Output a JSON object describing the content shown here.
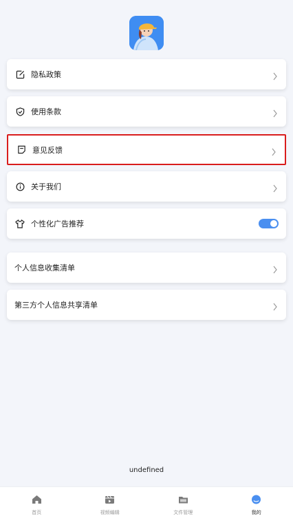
{
  "settings": {
    "items": [
      {
        "label": "隐私政策",
        "icon": "edit-icon"
      },
      {
        "label": "使用条款",
        "icon": "shield-check-icon"
      },
      {
        "label": "意见反馈",
        "icon": "feedback-icon"
      },
      {
        "label": "关于我们",
        "icon": "info-icon"
      }
    ],
    "personalized_ads": {
      "label": "个性化广告推荐",
      "icon": "tshirt-icon",
      "enabled": true
    },
    "lists": [
      {
        "label": "个人信息收集清单"
      },
      {
        "label": "第三方个人信息共享清单"
      }
    ]
  },
  "footer_text": "undefined",
  "tabbar": {
    "tabs": [
      {
        "label": "首页",
        "icon": "home-icon"
      },
      {
        "label": "视频编辑",
        "icon": "video-edit-icon"
      },
      {
        "label": "文件管理",
        "icon": "folder-icon"
      },
      {
        "label": "我的",
        "icon": "profile-icon",
        "active": true
      }
    ]
  },
  "colors": {
    "accent": "#4a8ff0",
    "highlight": "#d91c1c",
    "background": "#f3f5fa"
  }
}
